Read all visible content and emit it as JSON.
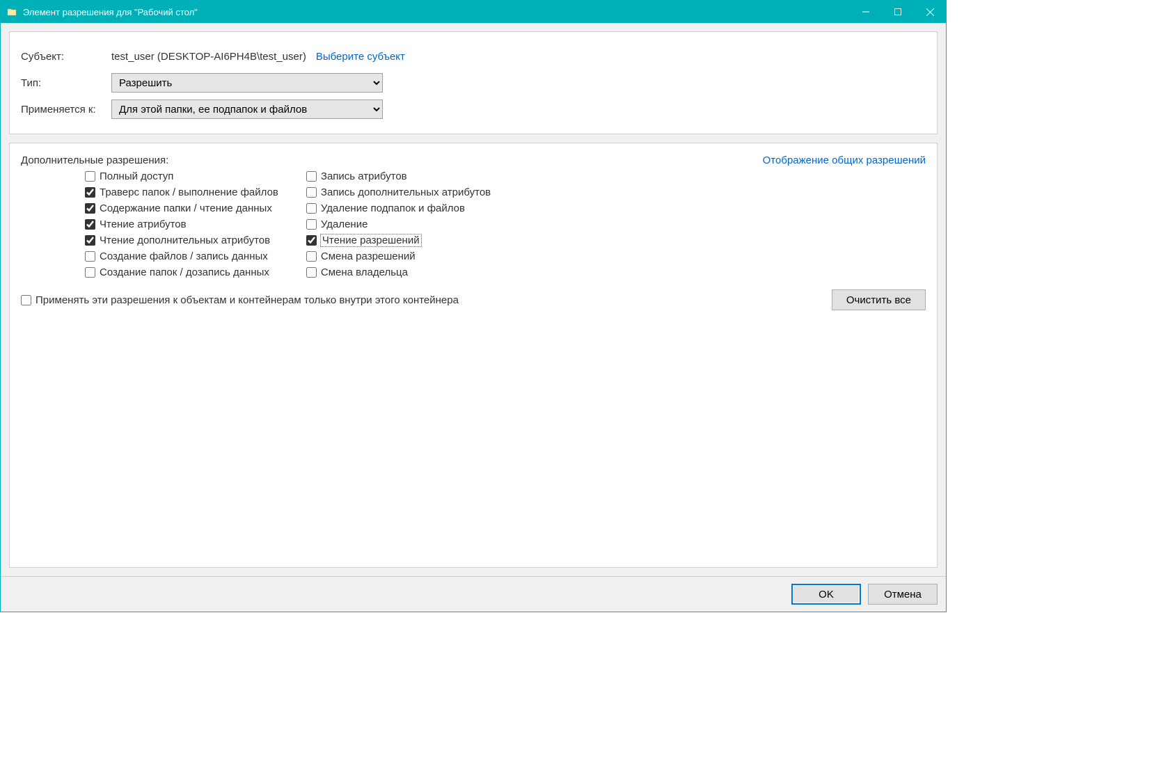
{
  "titlebar": {
    "title": "Элемент разрешения для \"Рабочий стол\""
  },
  "panel1": {
    "subject_label": "Субъект:",
    "subject_value": "test_user (DESKTOP-AI6PH4B\\test_user)",
    "select_subject_link": "Выберите субъект",
    "type_label": "Тип:",
    "type_value": "Разрешить",
    "applies_label": "Применяется к:",
    "applies_value": "Для этой папки, ее подпапок и файлов"
  },
  "panel2": {
    "extra_label": "Дополнительные разрешения:",
    "show_basic_link": "Отображение общих разрешений",
    "col1": [
      {
        "label": "Полный доступ",
        "checked": false
      },
      {
        "label": "Траверс папок / выполнение файлов",
        "checked": true
      },
      {
        "label": "Содержание папки / чтение данных",
        "checked": true
      },
      {
        "label": "Чтение атрибутов",
        "checked": true
      },
      {
        "label": "Чтение дополнительных атрибутов",
        "checked": true
      },
      {
        "label": "Создание файлов / запись данных",
        "checked": false
      },
      {
        "label": "Создание папок / дозапись данных",
        "checked": false
      }
    ],
    "col2": [
      {
        "label": "Запись атрибутов",
        "checked": false
      },
      {
        "label": "Запись дополнительных атрибутов",
        "checked": false
      },
      {
        "label": "Удаление подпапок и файлов",
        "checked": false
      },
      {
        "label": "Удаление",
        "checked": false
      },
      {
        "label": "Чтение разрешений",
        "checked": true,
        "focused": true
      },
      {
        "label": "Смена разрешений",
        "checked": false
      },
      {
        "label": "Смена владельца",
        "checked": false
      }
    ],
    "apply_only_label": "Применять эти разрешения к объектам и контейнерам только внутри этого контейнера",
    "clear_all_label": "Очистить все"
  },
  "footer": {
    "ok": "OK",
    "cancel": "Отмена"
  }
}
